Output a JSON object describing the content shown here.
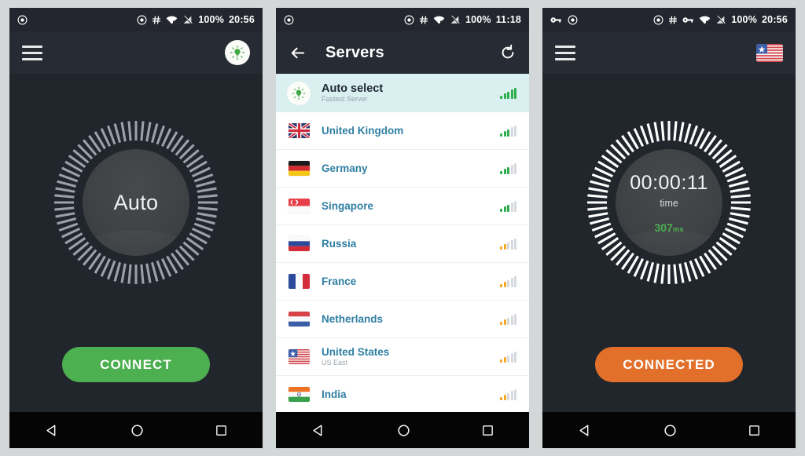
{
  "colors": {
    "page_background": "#d3d7d7",
    "app_background": "#21252c",
    "appbar": "#272b33",
    "statusbar": "#23262e",
    "connect_green": "#4caf50",
    "connected_orange": "#e2702a",
    "auto_row_highlight": "#d9eff0",
    "server_name_blue": "#2f7fa3",
    "signal_good": "#2eae4e",
    "signal_medium": "#f5a623",
    "signal_empty": "#d6dade",
    "ping_green": "#4caf50"
  },
  "panels": [
    {
      "id": "home-disconnected",
      "statusbar": {
        "left_icons": [
          "record-icon"
        ],
        "right_icons": [
          "record-icon",
          "hash-icon",
          "wifi-icon",
          "cell-signal-off-icon"
        ],
        "battery": "100%",
        "time": "20:56"
      },
      "appbar": {
        "menu_icon": "hamburger-icon",
        "title": "",
        "action_icon": "bulb-icon"
      },
      "dial": {
        "label": "Auto",
        "tick_count": 72,
        "tick_color": "#9aa1ab"
      },
      "cta": {
        "label": "CONNECT",
        "style": "green"
      },
      "navbar": [
        "back-icon",
        "home-icon",
        "recents-icon"
      ]
    },
    {
      "id": "servers-list",
      "statusbar": {
        "left_icons": [
          "record-icon"
        ],
        "right_icons": [
          "record-icon",
          "hash-icon",
          "wifi-icon",
          "cell-signal-off-icon"
        ],
        "battery": "100%",
        "time": "11:18"
      },
      "appbar": {
        "back_icon": "arrow-left-icon",
        "title": "Servers",
        "action_icon": "refresh-icon"
      },
      "servers": [
        {
          "name": "Auto select",
          "sub": "Fastest Server",
          "icon": "bulb-icon",
          "flag": "auto",
          "bars": 5,
          "quality": "good",
          "selected": true
        },
        {
          "name": "United Kingdom",
          "sub": "",
          "flag": "uk",
          "bars": 3,
          "quality": "good",
          "selected": false
        },
        {
          "name": "Germany",
          "sub": "",
          "flag": "de",
          "bars": 3,
          "quality": "good",
          "selected": false
        },
        {
          "name": "Singapore",
          "sub": "",
          "flag": "sg",
          "bars": 3,
          "quality": "good",
          "selected": false
        },
        {
          "name": "Russia",
          "sub": "",
          "flag": "ru",
          "bars": 2,
          "quality": "medium",
          "selected": false
        },
        {
          "name": "France",
          "sub": "",
          "flag": "fr",
          "bars": 2,
          "quality": "medium",
          "selected": false
        },
        {
          "name": "Netherlands",
          "sub": "",
          "flag": "nl",
          "bars": 2,
          "quality": "medium",
          "selected": false
        },
        {
          "name": "United States",
          "sub": "US East",
          "flag": "us",
          "bars": 2,
          "quality": "medium",
          "selected": false
        },
        {
          "name": "India",
          "sub": "",
          "flag": "in",
          "bars": 2,
          "quality": "medium",
          "selected": false
        }
      ],
      "navbar": [
        "back-icon",
        "home-icon",
        "recents-icon"
      ]
    },
    {
      "id": "home-connected",
      "statusbar": {
        "left_icons": [
          "vpn-key-icon",
          "record-icon"
        ],
        "right_icons": [
          "record-icon",
          "hash-icon",
          "vpn-key-icon",
          "wifi-icon",
          "cell-signal-off-icon"
        ],
        "battery": "100%",
        "time": "20:56"
      },
      "appbar": {
        "menu_icon": "hamburger-icon",
        "title": "",
        "action_icon": "us-flag-icon"
      },
      "dial": {
        "timer": "00:00:11",
        "timer_label": "time",
        "ping_value": "307",
        "ping_unit": "ms",
        "tick_count": 72,
        "tick_color": "#ffffff"
      },
      "cta": {
        "label": "CONNECTED",
        "style": "orange"
      },
      "navbar": [
        "back-icon",
        "home-icon",
        "recents-icon"
      ]
    }
  ]
}
